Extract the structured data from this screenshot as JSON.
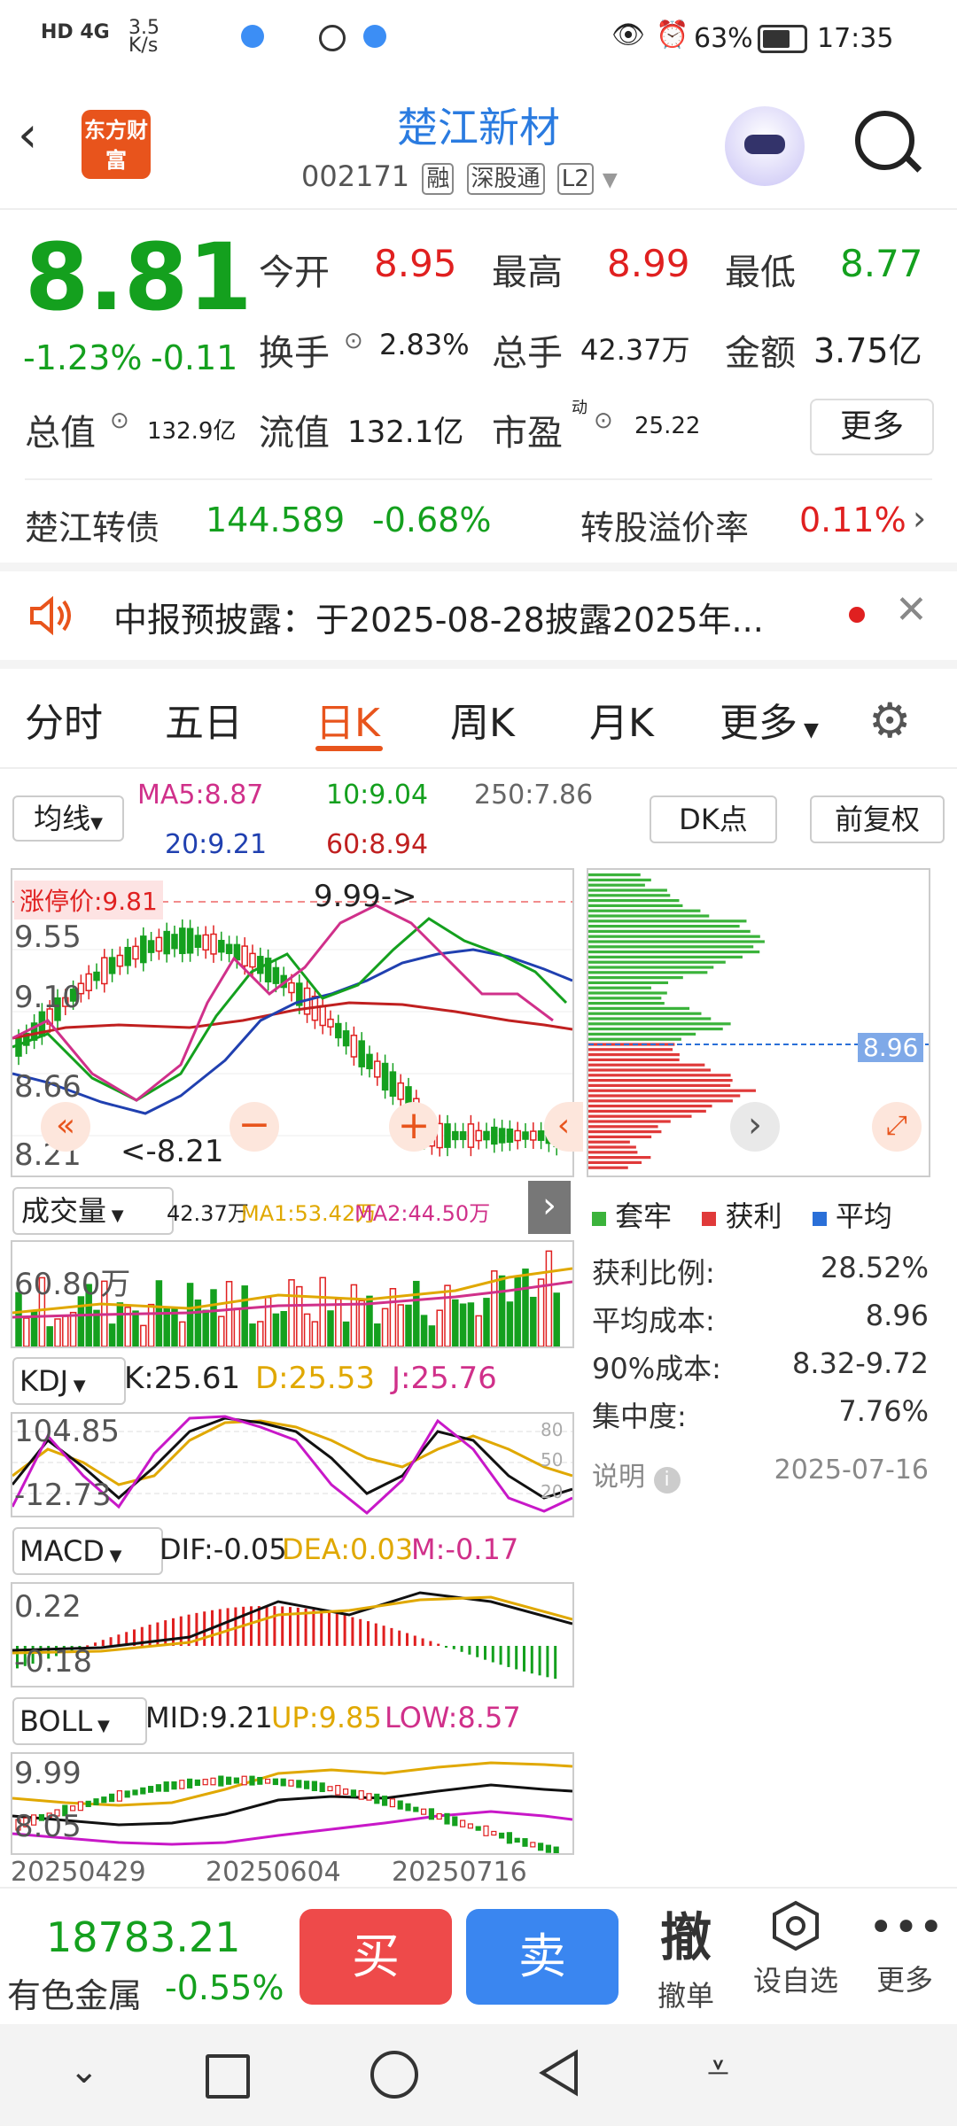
{
  "status_bar": {
    "left_text": "HD 4G",
    "speed": "3.5 K/s",
    "battery": "63%",
    "time": "17:35"
  },
  "header": {
    "title": "楚江新材",
    "code": "002171",
    "tags": [
      "融",
      "深股通",
      "L2"
    ],
    "logo_text": "东方财富"
  },
  "quote": {
    "price": "8.81",
    "change_pct": "-1.23%",
    "change": "-0.11",
    "open_label": "今开",
    "open": "8.95",
    "high_label": "最高",
    "high": "8.99",
    "low_label": "最低",
    "low": "8.77",
    "turnover_label": "换手",
    "turnover": "2.83%",
    "volume_label": "总手",
    "volume": "42.37万",
    "amount_label": "金额",
    "amount": "3.75亿",
    "total_cap_label": "总值",
    "total_cap": "132.9亿",
    "float_cap_label": "流值",
    "float_cap": "132.1亿",
    "pe_label": "市盈",
    "pe_sup": "动",
    "pe": "25.22",
    "more_button": "更多"
  },
  "bond": {
    "name": "楚江转债",
    "price": "144.589",
    "change": "-0.68%",
    "premium_label": "转股溢价率",
    "premium": "0.11%"
  },
  "notice": {
    "text": "中报预披露：于2025-08-28披露2025年..."
  },
  "tabs": [
    "分时",
    "五日",
    "日K",
    "周K",
    "月K",
    "更多"
  ],
  "active_tab": "日K",
  "ma": {
    "selector": "均线",
    "ma5": "MA5:8.87",
    "ma10": "10:9.04",
    "ma250": "250:7.86",
    "ma20": "20:9.21",
    "ma60": "60:8.94",
    "dk_button": "DK点",
    "adjust_button": "前复权"
  },
  "kline": {
    "limit_price": "涨停价:9.81",
    "y_labels": [
      "9.99",
      "9.55",
      "9.10",
      "8.66",
      "8.21"
    ],
    "high_mark": "9.99->",
    "low_mark": "<-8.21",
    "chip_price": "8.96"
  },
  "volume_ind": {
    "selector": "成交量",
    "vol": "42.37万",
    "ma1": "MA1:53.42万",
    "ma2": "MA2:44.50万",
    "y_label": "60.80万"
  },
  "kdj": {
    "selector": "KDJ",
    "k": "K:25.61",
    "d": "D:25.53",
    "j": "J:25.76",
    "y_top": "104.85",
    "y_bottom": "-12.73",
    "levels": [
      "80",
      "50",
      "20"
    ]
  },
  "macd": {
    "selector": "MACD",
    "dif": "DIF:-0.05",
    "dea": "DEA:0.03",
    "m": "M:-0.17",
    "y_top": "0.22",
    "y_bottom": "-0.18"
  },
  "boll": {
    "selector": "BOLL",
    "mid": "MID:9.21",
    "up": "UP:9.85",
    "low": "LOW:8.57",
    "y_top": "9.99",
    "y_bottom": "8.05"
  },
  "dates": [
    "20250429",
    "20250604",
    "20250716"
  ],
  "chips": {
    "legend": [
      "套牢",
      "获利",
      "平均"
    ],
    "rows": [
      {
        "label": "获利比例:",
        "value": "28.52%"
      },
      {
        "label": "平均成本:",
        "value": "8.96"
      },
      {
        "label": "90%成本:",
        "value": "8.32-9.72"
      },
      {
        "label": "集中度:",
        "value": "7.76%"
      }
    ],
    "explain": "说明",
    "date": "2025-07-16"
  },
  "bottom": {
    "index_value": "18783.21",
    "index_name": "有色金属",
    "index_change": "-0.55%",
    "buy": "买",
    "sell": "卖",
    "cancel_icon": "撤",
    "cancel": "撤单",
    "watch": "设自选",
    "more": "更多"
  },
  "colors": {
    "up": "#e02020",
    "down": "#14a01e",
    "accent": "#e8541c",
    "sell_blue": "#3a86f0"
  }
}
